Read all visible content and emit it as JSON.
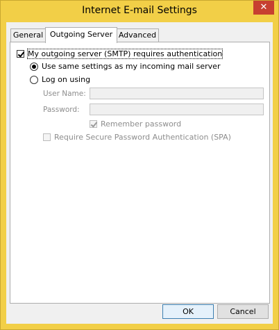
{
  "window": {
    "title": "Internet E-mail Settings",
    "close_glyph": "✕"
  },
  "tabs": [
    {
      "label": "General",
      "active": false
    },
    {
      "label": "Outgoing Server",
      "active": true
    },
    {
      "label": "Advanced",
      "active": false
    }
  ],
  "outgoing": {
    "smtp_auth": {
      "label": "My outgoing server (SMTP) requires authentication",
      "checked": true
    },
    "use_same": {
      "label": "Use same settings as my incoming mail server",
      "selected": true
    },
    "log_on": {
      "label": "Log on using",
      "selected": false
    },
    "user_name": {
      "label": "User Name:",
      "value": ""
    },
    "password": {
      "label": "Password:",
      "value": ""
    },
    "remember_password": {
      "label": "Remember password",
      "checked": true,
      "enabled": false
    },
    "require_spa": {
      "label": "Require Secure Password Authentication (SPA)",
      "checked": false,
      "enabled": false
    }
  },
  "buttons": {
    "ok": "OK",
    "cancel": "Cancel"
  }
}
